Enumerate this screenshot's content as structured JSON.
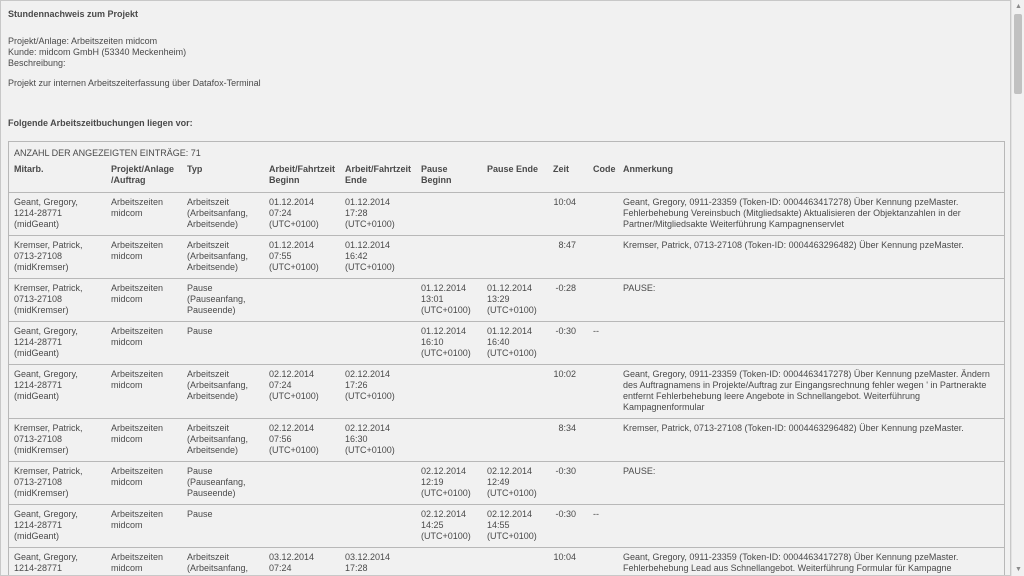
{
  "report": {
    "title": "Stundennachweis zum Projekt",
    "project": "Projekt/Anlage: Arbeitszeiten midcom",
    "customer": "Kunde: midcom GmbH (53340 Meckenheim)",
    "description_label": "Beschreibung:",
    "description": "Projekt zur internen Arbeitszeiterfassung über Datafox-Terminal",
    "bookings_heading": "Folgende Arbeitszeitbuchungen liegen vor:",
    "count_text": "ANZAHL DER ANGEZEIGTEN EINTRÄGE: 71"
  },
  "table": {
    "headers": {
      "mitarb": "Mitarb.",
      "projekt": "Projekt/Anlage /Auftrag",
      "typ": "Typ",
      "arbeit_beginn": "Arbeit/Fahrtzeit Beginn",
      "arbeit_ende": "Arbeit/Fahrtzeit Ende",
      "pause_beginn": "Pause Beginn",
      "pause_ende": "Pause Ende",
      "zeit": "Zeit",
      "code": "Code",
      "anmerkung": "Anmerkung"
    },
    "rows": [
      {
        "mitarb": [
          "Geant, Gregory,",
          "1214-28771",
          "(midGeant)"
        ],
        "projekt": [
          "Arbeitszeiten",
          "midcom"
        ],
        "typ": [
          "Arbeitszeit",
          "(Arbeitsanfang,",
          "Arbeitsende)"
        ],
        "arbeit_beginn": [
          "01.12.2014",
          "07:24",
          "(UTC+0100)"
        ],
        "arbeit_ende": [
          "01.12.2014",
          "17:28",
          "(UTC+0100)"
        ],
        "pause_beginn": [],
        "pause_ende": [],
        "zeit": "10:04",
        "code": "",
        "anmerkung": [
          "Geant, Gregory, 0911-23359 (Token-ID: 0004463417278) Über Kennung pzeMaster.",
          "Fehlerbehebung Vereinsbuch (Mitgliedsakte) Aktualisieren der Objektanzahlen in der",
          "Partner/Mitgliedsakte Weiterführung Kampagnenservlet"
        ]
      },
      {
        "mitarb": [
          "Kremser, Patrick,",
          "0713-27108",
          "(midKremser)"
        ],
        "projekt": [
          "Arbeitszeiten",
          "midcom"
        ],
        "typ": [
          "Arbeitszeit",
          "(Arbeitsanfang,",
          "Arbeitsende)"
        ],
        "arbeit_beginn": [
          "01.12.2014",
          "07:55",
          "(UTC+0100)"
        ],
        "arbeit_ende": [
          "01.12.2014",
          "16:42",
          "(UTC+0100)"
        ],
        "pause_beginn": [],
        "pause_ende": [],
        "zeit": "8:47",
        "code": "",
        "anmerkung": [
          "Kremser, Patrick, 0713-27108 (Token-ID: 0004463296482) Über Kennung pzeMaster."
        ]
      },
      {
        "mitarb": [
          "Kremser, Patrick,",
          "0713-27108",
          "(midKremser)"
        ],
        "projekt": [
          "Arbeitszeiten",
          "midcom"
        ],
        "typ": [
          "Pause",
          "(Pauseanfang,",
          "Pauseende)"
        ],
        "arbeit_beginn": [],
        "arbeit_ende": [],
        "pause_beginn": [
          "01.12.2014",
          "13:01",
          "(UTC+0100)"
        ],
        "pause_ende": [
          "01.12.2014",
          "13:29",
          "(UTC+0100)"
        ],
        "zeit": "-0:28",
        "code": "",
        "anmerkung": [
          "PAUSE:"
        ]
      },
      {
        "mitarb": [
          "Geant, Gregory,",
          "1214-28771",
          "(midGeant)"
        ],
        "projekt": [
          "Arbeitszeiten",
          "midcom"
        ],
        "typ": [
          "Pause"
        ],
        "arbeit_beginn": [],
        "arbeit_ende": [],
        "pause_beginn": [
          "01.12.2014",
          "16:10",
          "(UTC+0100)"
        ],
        "pause_ende": [
          "01.12.2014",
          "16:40",
          "(UTC+0100)"
        ],
        "zeit": "-0:30",
        "code": "--",
        "anmerkung": []
      },
      {
        "mitarb": [
          "Geant, Gregory,",
          "1214-28771",
          "(midGeant)"
        ],
        "projekt": [
          "Arbeitszeiten",
          "midcom"
        ],
        "typ": [
          "Arbeitszeit",
          "(Arbeitsanfang,",
          "Arbeitsende)"
        ],
        "arbeit_beginn": [
          "02.12.2014",
          "07:24",
          "(UTC+0100)"
        ],
        "arbeit_ende": [
          "02.12.2014",
          "17:26",
          "(UTC+0100)"
        ],
        "pause_beginn": [],
        "pause_ende": [],
        "zeit": "10:02",
        "code": "",
        "anmerkung": [
          "Geant, Gregory, 0911-23359 (Token-ID: 0004463417278) Über Kennung pzeMaster. Ändern",
          "des Auftragnamens in Projekte/Auftrag zur Eingangsrechnung fehler wegen ' in Partnerakte",
          "entfernt Fehlerbehebung leere Angebote in Schnellangebot. Weiterführung",
          "Kampagnenformular"
        ]
      },
      {
        "mitarb": [
          "Kremser, Patrick,",
          "0713-27108",
          "(midKremser)"
        ],
        "projekt": [
          "Arbeitszeiten",
          "midcom"
        ],
        "typ": [
          "Arbeitszeit",
          "(Arbeitsanfang,",
          "Arbeitsende)"
        ],
        "arbeit_beginn": [
          "02.12.2014",
          "07:56",
          "(UTC+0100)"
        ],
        "arbeit_ende": [
          "02.12.2014",
          "16:30",
          "(UTC+0100)"
        ],
        "pause_beginn": [],
        "pause_ende": [],
        "zeit": "8:34",
        "code": "",
        "anmerkung": [
          "Kremser, Patrick, 0713-27108 (Token-ID: 0004463296482) Über Kennung pzeMaster."
        ]
      },
      {
        "mitarb": [
          "Kremser, Patrick,",
          "0713-27108",
          "(midKremser)"
        ],
        "projekt": [
          "Arbeitszeiten",
          "midcom"
        ],
        "typ": [
          "Pause",
          "(Pauseanfang,",
          "Pauseende)"
        ],
        "arbeit_beginn": [],
        "arbeit_ende": [],
        "pause_beginn": [
          "02.12.2014",
          "12:19",
          "(UTC+0100)"
        ],
        "pause_ende": [
          "02.12.2014",
          "12:49",
          "(UTC+0100)"
        ],
        "zeit": "-0:30",
        "code": "",
        "anmerkung": [
          "PAUSE:"
        ]
      },
      {
        "mitarb": [
          "Geant, Gregory,",
          "1214-28771",
          "(midGeant)"
        ],
        "projekt": [
          "Arbeitszeiten",
          "midcom"
        ],
        "typ": [
          "Pause"
        ],
        "arbeit_beginn": [],
        "arbeit_ende": [],
        "pause_beginn": [
          "02.12.2014",
          "14:25",
          "(UTC+0100)"
        ],
        "pause_ende": [
          "02.12.2014",
          "14:55",
          "(UTC+0100)"
        ],
        "zeit": "-0:30",
        "code": "--",
        "anmerkung": []
      },
      {
        "mitarb": [
          "Geant, Gregory,",
          "1214-28771"
        ],
        "projekt": [
          "Arbeitszeiten",
          "midcom"
        ],
        "typ": [
          "Arbeitszeit",
          "(Arbeitsanfang,"
        ],
        "arbeit_beginn": [
          "03.12.2014",
          "07:24"
        ],
        "arbeit_ende": [
          "03.12.2014",
          "17:28"
        ],
        "pause_beginn": [],
        "pause_ende": [],
        "zeit": "10:04",
        "code": "",
        "anmerkung": [
          "Geant, Gregory, 0911-23359 (Token-ID: 0004463417278) Über Kennung pzeMaster.",
          "Fehlerbehebung Lead aus Schnellangebot. Weiterführung Formular für Kampagne"
        ]
      }
    ]
  }
}
